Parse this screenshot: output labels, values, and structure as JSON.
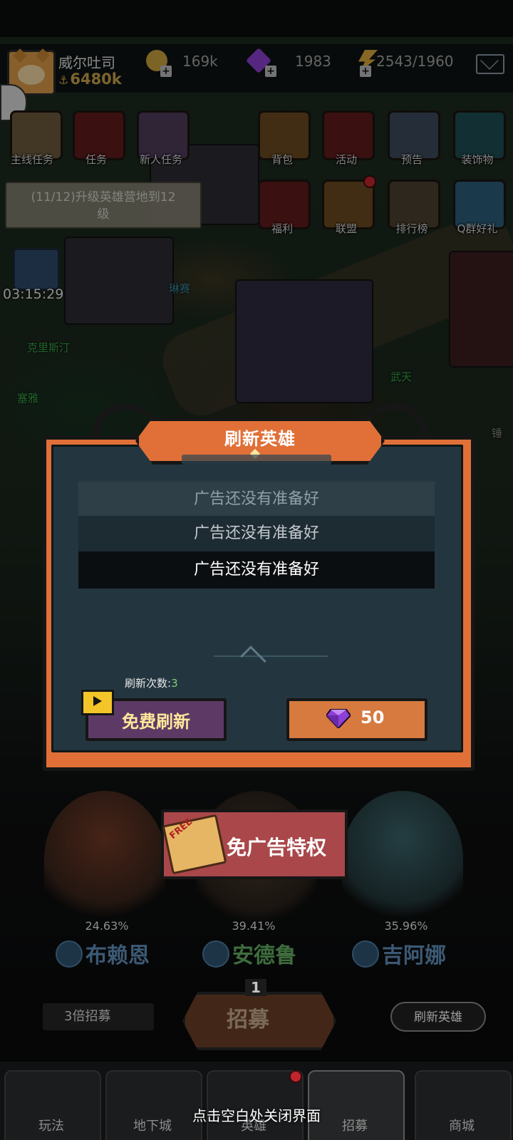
{
  "player": {
    "name": "威尔吐司",
    "power": "6480k"
  },
  "resources": {
    "gold": "169k",
    "gems": "1983",
    "energy": "2543/1960"
  },
  "menu": {
    "main_quest": "主线任务",
    "tasks": "任务",
    "newbie_tasks": "新人任务",
    "bag": "背包",
    "activity": "活动",
    "preview": "预告",
    "decorations": "装饰物",
    "welfare": "福利",
    "alliance": "联盟",
    "ranking": "排行榜",
    "qq_group": "Q群好礼"
  },
  "quest_tip": {
    "line1": "(11/12)升级英雄营地到12",
    "line2": "级"
  },
  "chest_timer": "03:15:29",
  "npc_names": [
    "琳赛",
    "克里斯汀",
    "塞雅",
    "武天",
    "锤"
  ],
  "dialog": {
    "title": "刷新英雄",
    "ad_lines": [
      "广告还没有准备好",
      "广告还没有准备好",
      "广告还没有准备好"
    ],
    "refresh_count_label": "刷新次数:",
    "refresh_count": "3",
    "free_refresh": "免费刷新",
    "gem_cost": "50"
  },
  "no_ads": "免广告特权",
  "ticket_label": "FREE",
  "heroes": [
    {
      "name": "布赖恩",
      "rate": "24.63%"
    },
    {
      "name": "安德鲁",
      "rate": "39.41%"
    },
    {
      "name": "吉阿娜",
      "rate": "35.96%"
    }
  ],
  "recruit": {
    "x3": "3倍招募",
    "label": "招募",
    "count": "1",
    "refresh_heroes": "刷新英雄"
  },
  "nav": [
    "玩法",
    "地下城",
    "英雄",
    "招募",
    "商城"
  ],
  "close_hint": "点击空白处关闭界面",
  "colors": {
    "dialog_orange": "#e07038",
    "dialog_bg": "#233640",
    "free_btn": "#5d3a66",
    "gem_btn": "#d67a3f",
    "refresh_green": "#7dd06f"
  }
}
